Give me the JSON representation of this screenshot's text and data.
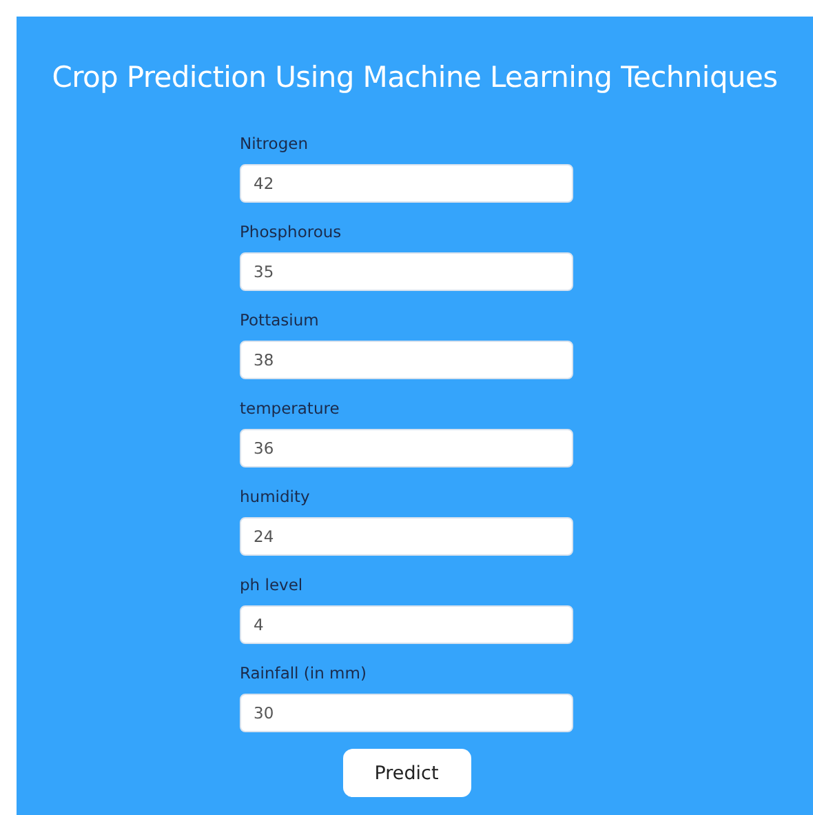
{
  "title": "Crop Prediction Using Machine Learning Techniques",
  "fields": [
    {
      "label": "Nitrogen",
      "value": "42"
    },
    {
      "label": "Phosphorous",
      "value": "35"
    },
    {
      "label": "Pottasium",
      "value": "38"
    },
    {
      "label": "temperature",
      "value": "36"
    },
    {
      "label": "humidity",
      "value": "24"
    },
    {
      "label": "ph level",
      "value": "4"
    },
    {
      "label": "Rainfall (in mm)",
      "value": "30"
    }
  ],
  "button": "Predict"
}
